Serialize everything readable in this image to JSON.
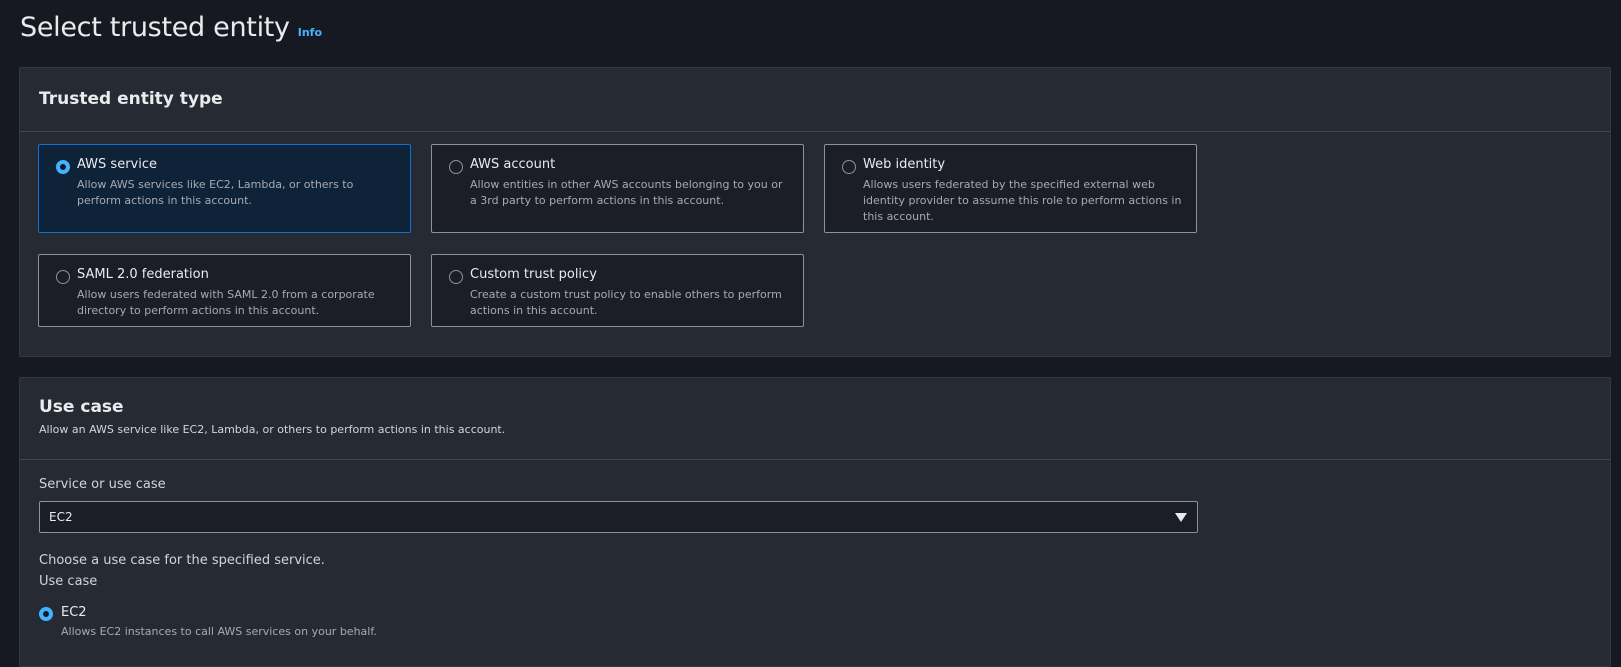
{
  "header": {
    "title": "Select trusted entity",
    "info_link": "Info"
  },
  "trusted_entity": {
    "title": "Trusted entity type",
    "options": [
      {
        "label": "AWS service",
        "description": "Allow AWS services like EC2, Lambda, or others to perform actions in this account.",
        "selected": true
      },
      {
        "label": "AWS account",
        "description": "Allow entities in other AWS accounts belonging to you or a 3rd party to perform actions in this account.",
        "selected": false
      },
      {
        "label": "Web identity",
        "description": "Allows users federated by the specified external web identity provider to assume this role to perform actions in this account.",
        "selected": false
      },
      {
        "label": "SAML 2.0 federation",
        "description": "Allow users federated with SAML 2.0 from a corporate directory to perform actions in this account.",
        "selected": false
      },
      {
        "label": "Custom trust policy",
        "description": "Create a custom trust policy to enable others to perform actions in this account.",
        "selected": false
      }
    ]
  },
  "use_case": {
    "title": "Use case",
    "description": "Allow an AWS service like EC2, Lambda, or others to perform actions in this account.",
    "service_label": "Service or use case",
    "service_value": "EC2",
    "choose_text": "Choose a use case for the specified service.",
    "use_case_label": "Use case",
    "options": [
      {
        "label": "EC2",
        "description": "Allows EC2 instances to call AWS services on your behalf.",
        "selected": true
      }
    ]
  },
  "colors": {
    "background": "#161922",
    "panel": "#262a33",
    "accent": "#42b4ff",
    "selected_border": "#0972d3"
  }
}
